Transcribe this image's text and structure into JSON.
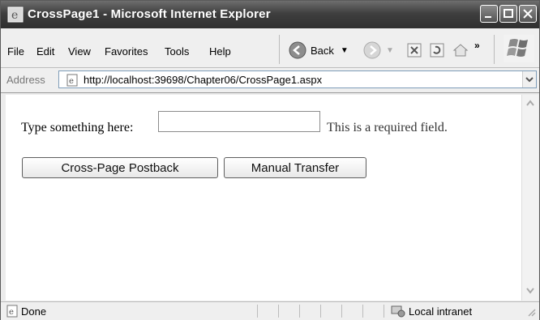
{
  "window": {
    "title": "CrossPage1 - Microsoft Internet Explorer"
  },
  "menu": {
    "items": [
      "File",
      "Edit",
      "View",
      "Favorites",
      "Tools",
      "Help"
    ]
  },
  "toolbar": {
    "back_label": "Back"
  },
  "address": {
    "label": "Address",
    "url": "http://localhost:39698/Chapter06/CrossPage1.aspx"
  },
  "page": {
    "prompt_label": "Type something here:",
    "input_value": "",
    "required_text": "This is a required field.",
    "button_cross": "Cross-Page Postback",
    "button_manual": "Manual Transfer"
  },
  "status": {
    "text": "Done",
    "zone": "Local intranet"
  }
}
